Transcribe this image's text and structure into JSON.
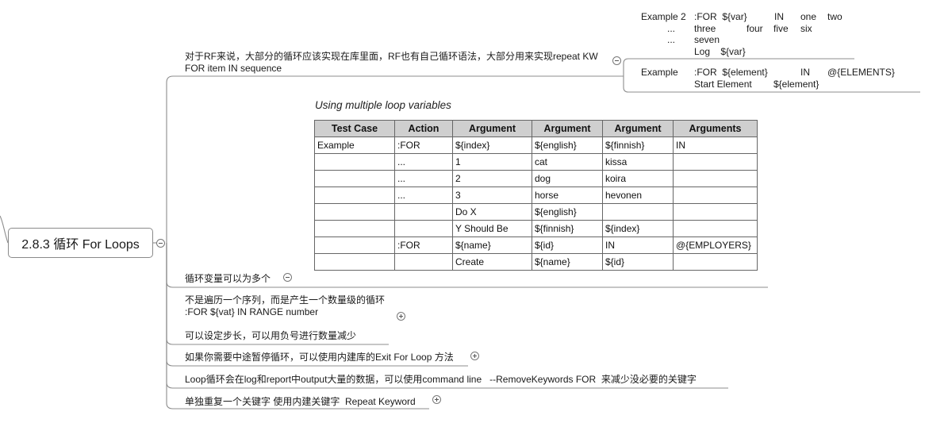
{
  "root": {
    "label": "2.8.3 循环 For Loops"
  },
  "branches": {
    "top_line1": "对于RF来说，大部分的循环应该实现在库里面，RF也有自己循环语法，大部分用来实现repeat KW",
    "top_line2": "FOR item IN sequence",
    "multi_vars": "循环变量可以为多个",
    "range_line1": "不是遍历一个序列，而是产生一个数量级的循环",
    "range_line2": ":FOR ${vat} IN RANGE number",
    "range_line3": "可以设定步长，可以用负号进行数量减少",
    "exit_loop": "如果你需要中途暂停循环，可以使用内建库的Exit For Loop 方法",
    "remove_kw": "Loop循环会在log和report中output大量的数据，可以使用command line   --RemoveKeywords FOR  来减少没必要的关键字",
    "repeat_kw": "单独重复一个关键字 使用内建关键字  Repeat Keyword"
  },
  "example2": {
    "col1": [
      "Example 2",
      "...",
      "..."
    ],
    "col2": [
      ":FOR  ${var}",
      "three",
      "seven",
      "Log    ${var}"
    ],
    "col3": [
      "IN",
      "four"
    ],
    "col4": [
      "one",
      "five"
    ],
    "col5": [
      "two",
      "six"
    ]
  },
  "example1": {
    "col1": [
      "Example"
    ],
    "col2": [
      ":FOR  ${element}",
      "Start Element"
    ],
    "col3": [
      "IN",
      "${element}"
    ],
    "col4": [
      "@{ELEMENTS}"
    ]
  },
  "loop_table": {
    "title": "Using multiple loop variables",
    "headers": [
      "Test Case",
      "Action",
      "Argument",
      "Argument",
      "Argument",
      "Arguments"
    ],
    "rows": [
      [
        "Example",
        ":FOR",
        "${index}",
        "${english}",
        "${finnish}",
        "IN"
      ],
      [
        "",
        "...",
        "1",
        "cat",
        "kissa",
        ""
      ],
      [
        "",
        "...",
        "2",
        "dog",
        "koira",
        ""
      ],
      [
        "",
        "...",
        "3",
        "horse",
        "hevonen",
        ""
      ],
      [
        "",
        "",
        "Do X",
        "${english}",
        "",
        ""
      ],
      [
        "",
        "",
        "Y Should Be",
        "${finnish}",
        "${index}",
        ""
      ],
      [
        "",
        ":FOR",
        "${name}",
        "${id}",
        "IN",
        "@{EMPLOYERS}"
      ],
      [
        "",
        "",
        "Create",
        "${name}",
        "${id}",
        ""
      ]
    ]
  }
}
